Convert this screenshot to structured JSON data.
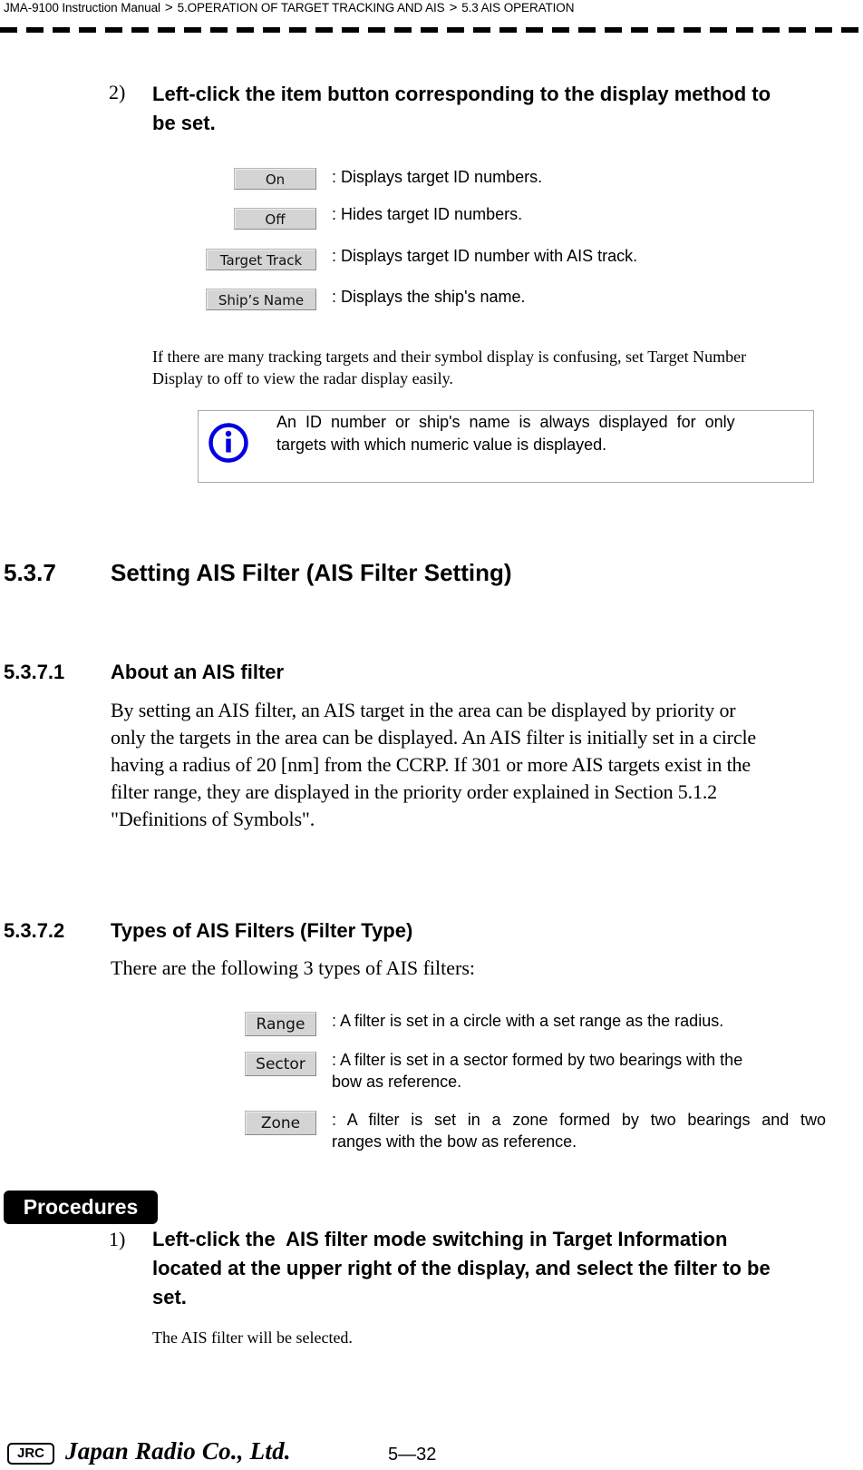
{
  "header": {
    "breadcrumb": [
      "JMA-9100 Instruction Manual",
      "5.OPERATION OF TARGET TRACKING AND AIS",
      "5.3  AIS OPERATION"
    ],
    "separator": ">"
  },
  "step2": {
    "number": "2)",
    "line1": "Left-click the item button corresponding to the display method to",
    "line2": "be set."
  },
  "display_options": [
    {
      "button": "On",
      "description": ": Displays target ID numbers."
    },
    {
      "button": "Off",
      "description": ": Hides target ID numbers."
    },
    {
      "button": "Target Track",
      "description": ": Displays target ID number with AIS track."
    },
    {
      "button": "Ship’s Name",
      "description": ": Displays the ship's name."
    }
  ],
  "tip": {
    "line1": "If there are many tracking targets and their symbol display is confusing, set Target Number",
    "line2": "Display to off to view the radar display easily."
  },
  "note": {
    "icon": "info-icon",
    "icon_color": "#0000e0",
    "line1": "An  ID  number  or  ship's  name  is  always  displayed  for  only",
    "line2": "targets with which numeric value is displayed."
  },
  "section_537": {
    "number": "5.3.7",
    "title": "Setting AIS Filter (AIS Filter Setting)"
  },
  "section_5371": {
    "number": "5.3.7.1",
    "title": "About an AIS filter",
    "lines": [
      "By setting an AIS filter, an AIS target in the area can be displayed by priority or",
      "only the targets in the area can be displayed. An AIS filter is initially set in a circle",
      "having a radius of 20 [nm] from the CCRP. If 301 or more AIS targets exist in the",
      "filter range, they are displayed in the priority order explained in Section 5.1.2",
      "\"Definitions of Symbols\"."
    ]
  },
  "section_5372": {
    "number": "5.3.7.2",
    "title": "Types of AIS Filters (Filter Type)",
    "intro": "There are the following 3 types of AIS filters:"
  },
  "filter_types": [
    {
      "button": "Range",
      "lines": [
        ": A filter is set in a circle with a set range as the radius."
      ]
    },
    {
      "button": "Sector",
      "lines": [
        ": A filter is set in a sector formed by two bearings with the",
        "bow as reference."
      ]
    },
    {
      "button": "Zone",
      "lines": [
        ": A filter is set in a zone formed by two bearings and two",
        "ranges with the bow as reference."
      ]
    }
  ],
  "procedures": {
    "badge": "Procedures",
    "step1": {
      "number": "1)",
      "line1": "Left-click the  AIS filter mode switching in Target Information",
      "line2": "located at the upper right of the display, and select the filter to be",
      "line3": "set.",
      "result": "The AIS filter will be selected."
    }
  },
  "footer": {
    "logo": "JRC",
    "brand": "Japan Radio Co., Ltd.",
    "page": "5—32"
  }
}
